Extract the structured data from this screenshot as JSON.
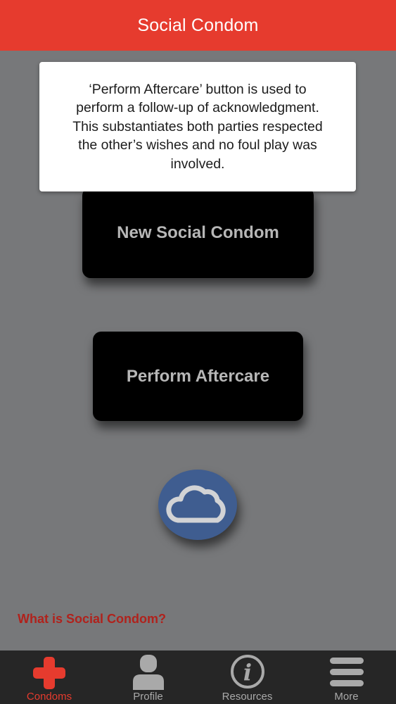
{
  "header": {
    "title": "Social Condom"
  },
  "main": {
    "new_button_label": "New Social Condom",
    "aftercare_button_label": "Perform Aftercare",
    "what_link": "What is Social Condom?"
  },
  "tooltip": {
    "lines": [
      "‘Perform Aftercare’ button is used to",
      "perform a follow-up of acknowledgment.",
      "This substantiates both parties respected",
      "the other’s wishes and no foul play was",
      "involved."
    ]
  },
  "tabs": [
    {
      "label": "Condoms",
      "icon": "red-cross-icon",
      "active": true
    },
    {
      "label": "Profile",
      "icon": "person-icon",
      "active": false
    },
    {
      "label": "Resources",
      "icon": "info-icon",
      "active": false
    },
    {
      "label": "More",
      "icon": "menu-icon",
      "active": false
    }
  ],
  "colors": {
    "brand_red": "#e63b2e",
    "cloud_button": "#3f5d90",
    "link_red": "#b0221c",
    "tab_inactive": "#a9a9a9"
  }
}
